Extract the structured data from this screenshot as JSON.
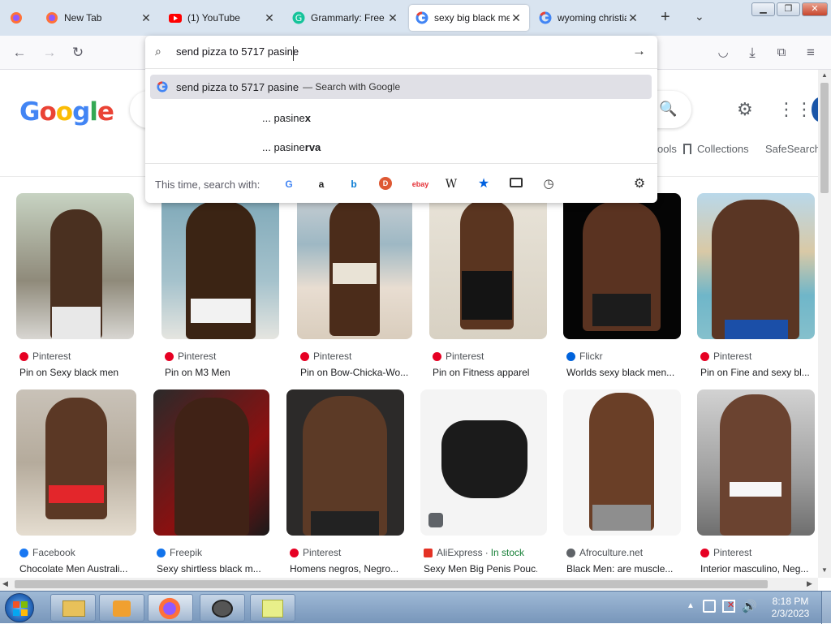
{
  "tabs": [
    {
      "title": "",
      "favicon": "firefox-icon"
    },
    {
      "title": "New Tab",
      "favicon": "firefox-icon"
    },
    {
      "title": "(1) YouTube",
      "favicon": "youtube-icon"
    },
    {
      "title": "Grammarly: Free O",
      "favicon": "grammarly-icon"
    },
    {
      "title": "sexy big black me",
      "favicon": "google-icon",
      "active": true
    },
    {
      "title": "wyoming christia",
      "favicon": "google-icon"
    }
  ],
  "url_panel": {
    "input_value": "send pizza to 5717 pasine",
    "suggestions": [
      {
        "text": "send pizza to 5717 pasine",
        "suffix": "— Search with Google"
      },
      {
        "prefix": "... pasine",
        "bold": "x"
      },
      {
        "prefix": "... pasine",
        "bold": "rva"
      }
    ],
    "search_with_label": "This time, search with:",
    "engines": [
      "google",
      "amazon",
      "bing",
      "duckduckgo",
      "ebay",
      "wikipedia",
      "bookmarks",
      "tabs",
      "history"
    ]
  },
  "google": {
    "logo": "Google",
    "tools_label": "ools",
    "collections_label": "Collections",
    "safesearch_label": "SafeSearch"
  },
  "results": [
    {
      "source": "Pinterest",
      "caption": "Pin on Sexy black men",
      "source_color": "#e60023"
    },
    {
      "source": "Pinterest",
      "caption": "Pin on M3 Men",
      "source_color": "#e60023"
    },
    {
      "source": "Pinterest",
      "caption": "Pin on Bow-Chicka-Wo...",
      "source_color": "#e60023"
    },
    {
      "source": "Pinterest",
      "caption": "Pin on Fitness apparel",
      "source_color": "#e60023"
    },
    {
      "source": "Flickr",
      "caption": "Worlds sexy black men...",
      "source_color": "#0063dc"
    },
    {
      "source": "Pinterest",
      "caption": "Pin on Fine and sexy bl...",
      "source_color": "#e60023"
    },
    {
      "source": "Facebook",
      "caption": "Chocolate Men Australi...",
      "source_color": "#1877f2"
    },
    {
      "source": "Freepik",
      "caption": "Sexy shirtless black m...",
      "source_color": "#1273eb"
    },
    {
      "source": "Pinterest",
      "caption": "Homens negros, Negro...",
      "source_color": "#e60023"
    },
    {
      "source": "AliExpress",
      "source_extra": "In stock",
      "caption": "Sexy Men Big Penis Pouc...",
      "source_color": "#e43225"
    },
    {
      "source": "Afroculture.net",
      "caption": "Black Men: are muscle...",
      "source_color": "#5f6368"
    },
    {
      "source": "Pinterest",
      "caption": "Interior masculino, Neg...",
      "source_color": "#e60023"
    }
  ],
  "taskbar": {
    "time": "8:18 PM",
    "date": "2/3/2023"
  }
}
